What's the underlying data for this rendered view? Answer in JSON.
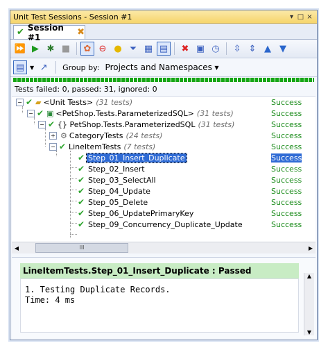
{
  "window": {
    "title": "Unit Test Sessions - Session #1",
    "controls": [
      "▾",
      "□",
      "×"
    ]
  },
  "tab": {
    "label": "Session #1"
  },
  "groupby": {
    "label": "Group by:",
    "value": "Projects and Namespaces"
  },
  "status": {
    "text": "Tests failed: 0, passed: 31, ignored: 0"
  },
  "tree": {
    "rows": [
      {
        "label": "<Unit Tests>",
        "count": "(31 tests)",
        "result": "Success"
      },
      {
        "label": "<PetShop.Tests.ParameterizedSQL>",
        "count": "(31 tests)",
        "result": "Success"
      },
      {
        "label": "{} PetShop.Tests.ParameterizedSQL",
        "count": "(31 tests)",
        "result": "Success"
      },
      {
        "label": "CategoryTests",
        "count": "(24 tests)",
        "result": "Success"
      },
      {
        "label": "LineItemTests",
        "count": "(7 tests)",
        "result": "Success"
      },
      {
        "label": "Step_01_Insert_Duplicate",
        "count": "",
        "result": "Success"
      },
      {
        "label": "Step_02_Insert",
        "count": "",
        "result": "Success"
      },
      {
        "label": "Step_03_SelectAll",
        "count": "",
        "result": "Success"
      },
      {
        "label": "Step_04_Update",
        "count": "",
        "result": "Success"
      },
      {
        "label": "Step_05_Delete",
        "count": "",
        "result": "Success"
      },
      {
        "label": "Step_06_UpdatePrimaryKey",
        "count": "",
        "result": "Success"
      },
      {
        "label": "Step_09_Concurrency_Duplicate_Update",
        "count": "",
        "result": "Success"
      }
    ]
  },
  "details": {
    "title": "LineItemTests.Step_01_Insert_Duplicate : Passed",
    "line1": "1. Testing Duplicate Records.",
    "line2": "Time: 4 ms"
  },
  "colors": {
    "success": "#1c8c1c",
    "selection": "#2f6bd5",
    "progress": "#16a616"
  },
  "progress": {
    "passed_fraction": 1.0
  }
}
